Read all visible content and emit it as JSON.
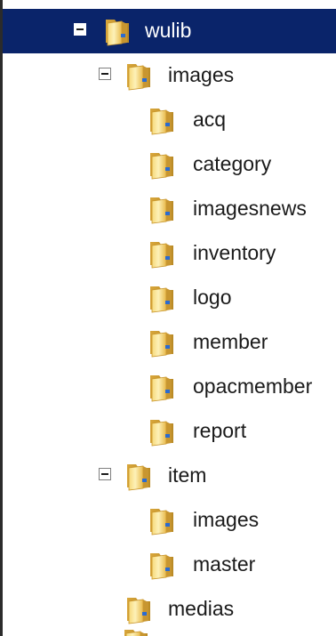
{
  "folder_icon": "folder-icon",
  "toggle_icon": "collapse-toggle-icon",
  "colors": {
    "selection": "#0a246a",
    "folder_light": "#fde79a",
    "folder_dark": "#d9a832"
  },
  "tree": {
    "root": {
      "label": "wulib",
      "expanded": true,
      "selected": true
    },
    "images": {
      "label": "images",
      "expanded": true
    },
    "images_children": [
      {
        "label": "acq"
      },
      {
        "label": "category"
      },
      {
        "label": "imagesnews"
      },
      {
        "label": "inventory"
      },
      {
        "label": "logo"
      },
      {
        "label": "member"
      },
      {
        "label": "opacmember"
      },
      {
        "label": "report"
      }
    ],
    "item": {
      "label": "item",
      "expanded": true
    },
    "item_children": [
      {
        "label": "images"
      },
      {
        "label": "master"
      }
    ],
    "medias": {
      "label": "medias"
    }
  }
}
